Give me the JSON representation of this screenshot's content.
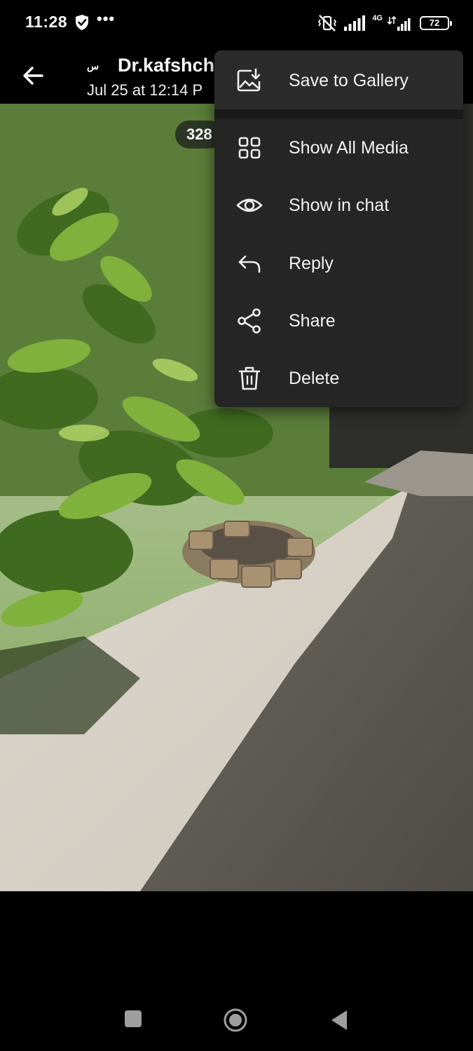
{
  "status_bar": {
    "time": "11:28",
    "more": "•••",
    "network_label": "4G",
    "battery": "72"
  },
  "header": {
    "sender_badge": "س",
    "sender_name": "Dr.kafshch",
    "sent_date": "Jul 25 at 12:14 P"
  },
  "photo": {
    "counter": "328"
  },
  "menu": {
    "items": [
      {
        "label": "Save to Gallery",
        "icon": "save-to-gallery-icon"
      },
      {
        "label": "Show All Media",
        "icon": "grid-icon"
      },
      {
        "label": "Show in chat",
        "icon": "eye-icon"
      },
      {
        "label": "Reply",
        "icon": "reply-icon"
      },
      {
        "label": "Share",
        "icon": "share-icon"
      },
      {
        "label": "Delete",
        "icon": "trash-icon"
      }
    ]
  },
  "colors": {
    "menu_background": "#262626",
    "menu_text": "#f2f2f2",
    "background": "#000000"
  }
}
